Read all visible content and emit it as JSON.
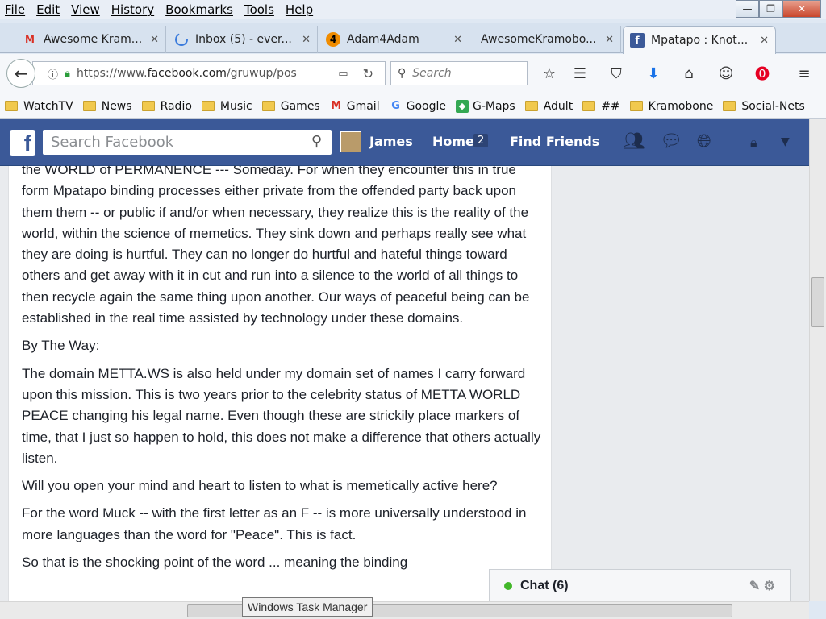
{
  "menu": [
    "File",
    "Edit",
    "View",
    "History",
    "Bookmarks",
    "Tools",
    "Help"
  ],
  "window_controls": {
    "minimize": "—",
    "maximize": "❐",
    "close": "✕"
  },
  "tabs": [
    {
      "label": "Awesome Kram...",
      "icon": "gmail-icon",
      "active": false
    },
    {
      "label": "Inbox (5) - ever...",
      "icon": "loading-icon",
      "active": false
    },
    {
      "label": "Adam4Adam",
      "icon": "adam4adam-icon",
      "active": false
    },
    {
      "label": "AwesomeKramobo...",
      "icon": "none",
      "active": false
    },
    {
      "label": "Mpatapo : Knot...",
      "icon": "facebook-icon",
      "active": true
    }
  ],
  "tab_close": "✕",
  "new_tab": "+",
  "address": {
    "protocol": "https://www.",
    "domain": "facebook.com",
    "path": "/gruwup/pos"
  },
  "search_placeholder": "Search",
  "bookmarks": [
    {
      "label": "WatchTV",
      "icon": "folder-icon"
    },
    {
      "label": "News",
      "icon": "folder-icon"
    },
    {
      "label": "Radio",
      "icon": "folder-icon"
    },
    {
      "label": "Music",
      "icon": "folder-icon"
    },
    {
      "label": "Games",
      "icon": "folder-icon"
    },
    {
      "label": "Gmail",
      "icon": "gmail-icon"
    },
    {
      "label": "Google",
      "icon": "google-icon"
    },
    {
      "label": "G-Maps",
      "icon": "maps-icon"
    },
    {
      "label": "Adult",
      "icon": "folder-icon"
    },
    {
      "label": "##",
      "icon": "folder-icon"
    },
    {
      "label": "Kramobone",
      "icon": "folder-icon"
    },
    {
      "label": "Social-Nets",
      "icon": "folder-icon"
    }
  ],
  "facebook": {
    "logo": "f",
    "search_placeholder": "Search Facebook",
    "user_name": "James",
    "home_label": "Home",
    "home_count": "2",
    "find_friends": "Find Friends"
  },
  "post": {
    "paragraphs": [
      "the WORLD of PERMANENCE --- Someday. For when they encounter this in true form Mpatapo binding processes either private from the offended party back upon them them -- or public if and/or when necessary, they realize this is the reality of the world, within the science of memetics. They sink down and perhaps really see what they are doing is hurtful. They can no longer do hurtful and hateful things toward others and get away with it in cut and run into a silence to the world of all things to then recycle again the same thing upon another. Our ways of peaceful being can be established in the real time assisted by technology under these domains.",
      "By The Way:",
      "The domain METTA.WS is also held under my domain set of names I carry forward upon this mission. This is two years prior to the celebrity status of METTA WORLD PEACE changing his legal name. Even though these are strickily place markers of time, that I just so happen to hold, this does not make a difference that others actually listen.",
      "Will you open your mind and heart to listen to what is memetically active here?",
      "For the word Muck -- with the first letter as an F -- is more universally understood in more languages than the word for \"Peace\". This is fact.",
      "So that is the shocking point of the word ... meaning the binding"
    ]
  },
  "chat": {
    "label": "Chat (6)"
  },
  "tooltip": "Windows Task Manager"
}
